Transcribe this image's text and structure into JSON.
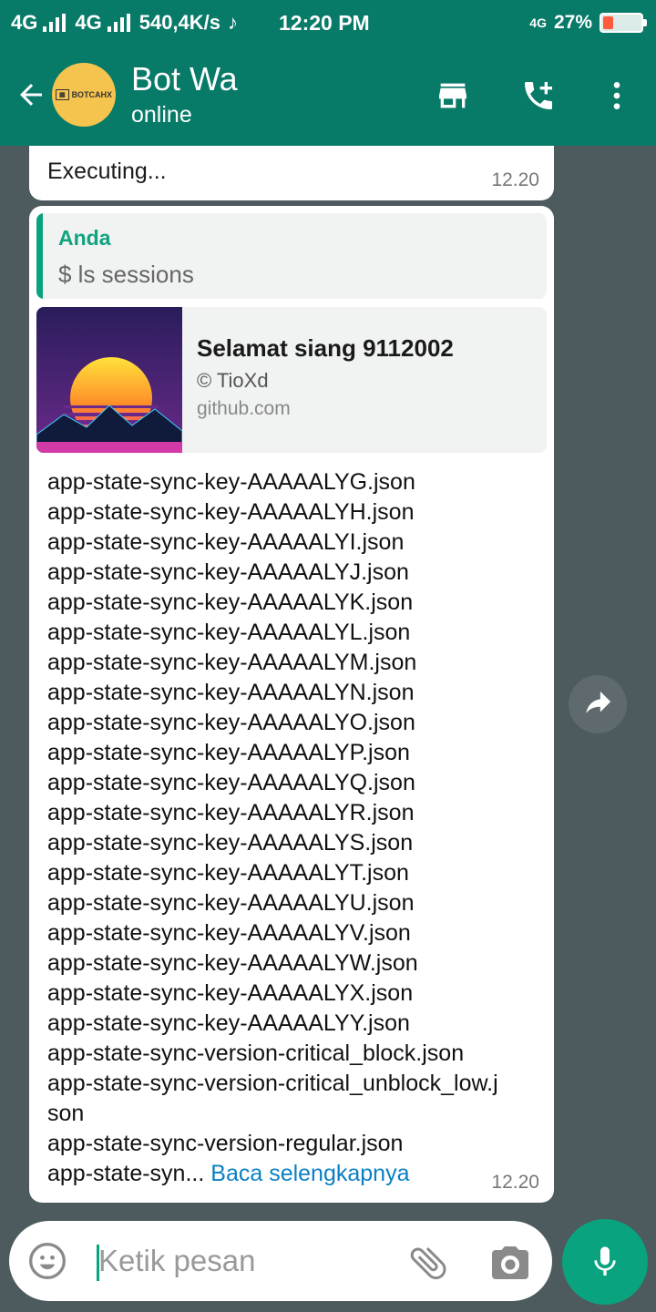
{
  "status_bar": {
    "network1": "4G",
    "network2": "4G",
    "speed": "540,4K/s",
    "time": "12:20 PM",
    "network_right": "4G",
    "battery_percent": "27%",
    "battery_level": 0.27
  },
  "header": {
    "contact_name": "Bot Wa",
    "contact_status": "online",
    "avatar_text": "BOTCAHX",
    "icons": [
      "back-arrow-icon",
      "store-icon",
      "add-call-icon",
      "more-vert-icon"
    ]
  },
  "messages": [
    {
      "text": "Executing...",
      "time": "12.20"
    },
    {
      "quote": {
        "author": "Anda",
        "text": "$ ls sessions"
      },
      "link_preview": {
        "title": "Selamat siang 9112002",
        "description": "© TioXd",
        "domain": "github.com"
      },
      "lines": [
        "app-state-sync-key-AAAAALYG.json",
        "app-state-sync-key-AAAAALYH.json",
        "app-state-sync-key-AAAAALYI.json",
        "app-state-sync-key-AAAAALYJ.json",
        "app-state-sync-key-AAAAALYK.json",
        "app-state-sync-key-AAAAALYL.json",
        "app-state-sync-key-AAAAALYM.json",
        "app-state-sync-key-AAAAALYN.json",
        "app-state-sync-key-AAAAALYO.json",
        "app-state-sync-key-AAAAALYP.json",
        "app-state-sync-key-AAAAALYQ.json",
        "app-state-sync-key-AAAAALYR.json",
        "app-state-sync-key-AAAAALYS.json",
        "app-state-sync-key-AAAAALYT.json",
        "app-state-sync-key-AAAAALYU.json",
        "app-state-sync-key-AAAAALYV.json",
        "app-state-sync-key-AAAAALYW.json",
        "app-state-sync-key-AAAAALYX.json",
        "app-state-sync-key-AAAAALYY.json",
        "app-state-sync-version-critical_block.json",
        "app-state-sync-version-critical_unblock_low.j",
        "son",
        "app-state-sync-version-regular.json"
      ],
      "last_line_prefix": "app-state-syn...",
      "read_more": "Baca selengkapnya",
      "time": "12.20"
    }
  ],
  "input": {
    "placeholder": "Ketik pesan"
  },
  "colors": {
    "header": "#077a68",
    "accent": "#0aa37f",
    "link": "#0b7fc4",
    "chat_bg": "#4d5a5e"
  }
}
